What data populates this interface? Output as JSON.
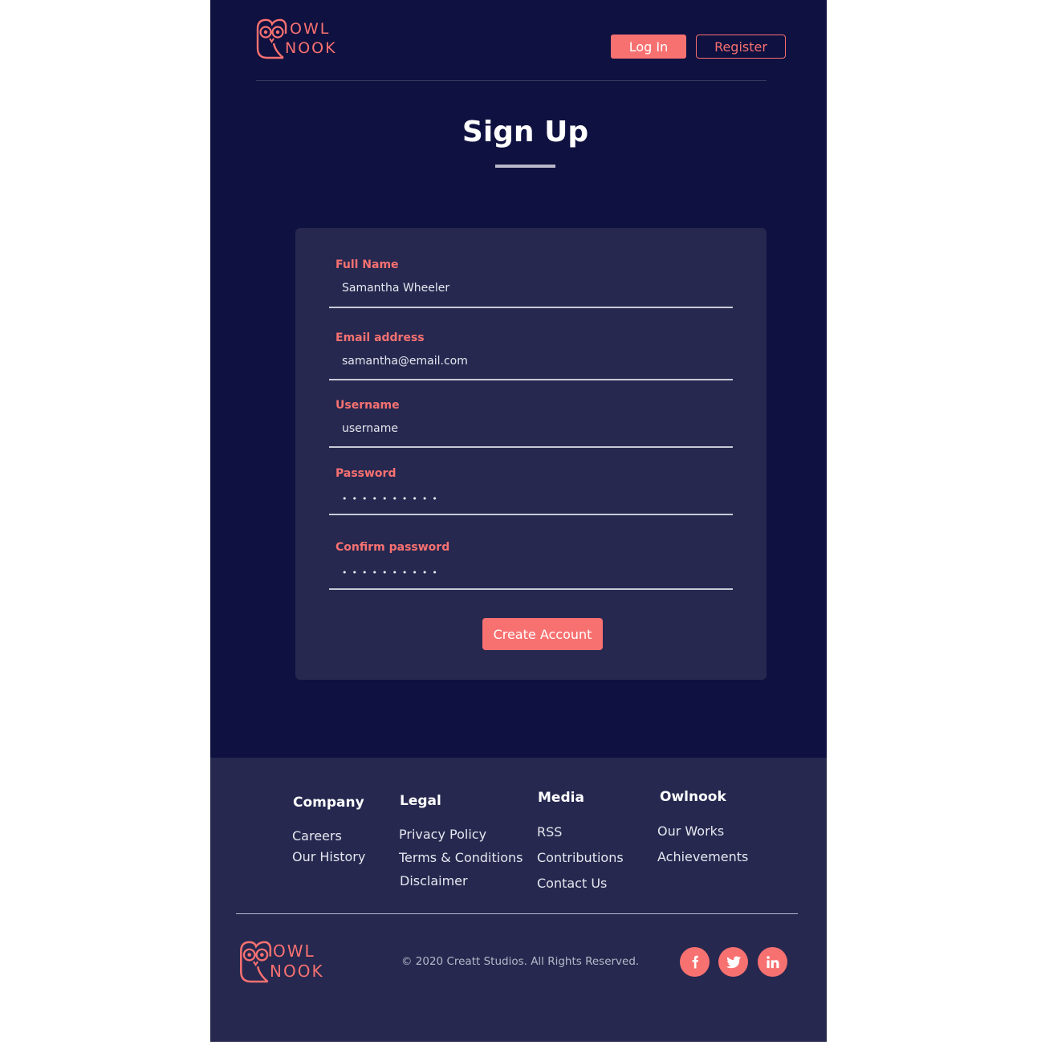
{
  "brand": {
    "line1": "OWL",
    "line2": "NOOK",
    "accent_color": "#f87171",
    "background_color": "#0f1140",
    "card_color": "#26284f"
  },
  "header": {
    "login_label": "Log In",
    "register_label": "Register"
  },
  "page_title": "Sign Up",
  "form": {
    "fields": [
      {
        "label": "Full Name",
        "value": "Samantha Wheeler",
        "type": "text"
      },
      {
        "label": "Email address",
        "value": "samantha@email.com",
        "type": "email"
      },
      {
        "label": "Username",
        "value": "",
        "placeholder": "username",
        "type": "text"
      },
      {
        "label": "Password",
        "value": "••••••••••",
        "type": "password"
      },
      {
        "label": "Confirm password",
        "value": "••••••••••",
        "type": "password"
      }
    ],
    "submit_label": "Create Account"
  },
  "footer": {
    "columns": [
      {
        "title": "Company",
        "links": [
          "Careers",
          "Our History"
        ]
      },
      {
        "title": "Legal",
        "links": [
          "Privacy Policy",
          "Terms & Conditions",
          "Disclaimer"
        ]
      },
      {
        "title": "Media",
        "links": [
          "RSS",
          "Contributions",
          "Contact Us"
        ]
      },
      {
        "title": "Owlnook",
        "links": [
          "Our Works",
          "Achievements"
        ]
      }
    ],
    "copyright": "© 2020 Creatt Studios. All Rights Reserved.",
    "social": [
      {
        "name": "facebook-icon"
      },
      {
        "name": "twitter-icon"
      },
      {
        "name": "linkedin-icon"
      }
    ]
  }
}
